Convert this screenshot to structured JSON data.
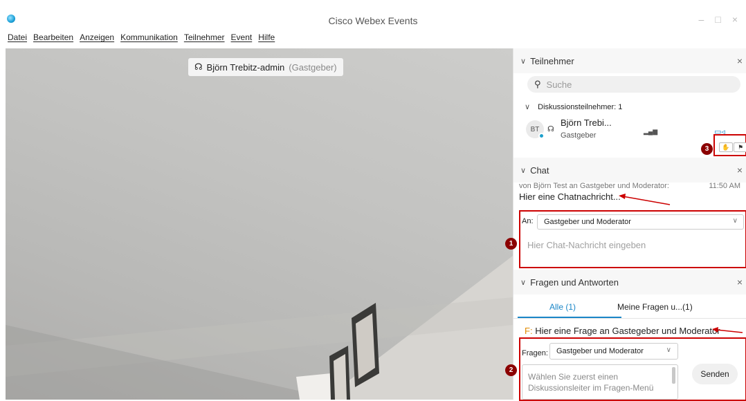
{
  "window": {
    "title": "Cisco Webex Events",
    "controls": [
      "–",
      "□",
      "×"
    ]
  },
  "menu": [
    "Datei",
    "Bearbeiten",
    "Anzeigen",
    "Kommunikation",
    "Teilnehmer",
    "Event",
    "Hilfe"
  ],
  "video": {
    "speaker_name": "Björn Trebitz-admin",
    "speaker_role": "(Gastgeber)"
  },
  "participants": {
    "header": "Teilnehmer",
    "search_placeholder": "Suche",
    "panelists_label": "Diskussionsteilnehmer: 1",
    "items": [
      {
        "initials": "BT",
        "name": "Björn Trebi...",
        "role": "Gastgeber"
      }
    ]
  },
  "chat": {
    "header": "Chat",
    "message_meta": "von Björn Test an Gastgeber und Moderator:",
    "message_time": "11:50 AM",
    "message_text": "Hier eine Chatnachricht...",
    "to_label": "An:",
    "to_value": "Gastgeber und Moderator",
    "input_placeholder": "Hier Chat-Nachricht eingeben"
  },
  "qa": {
    "header": "Fragen und Antworten",
    "tabs": [
      "Alle (1)",
      "Meine Fragen u...(1)"
    ],
    "question_prefix": "F:",
    "question_text": "Hier eine Frage an Gastegeber und Moderator",
    "ask_label": "Fragen:",
    "ask_value": "Gastgeber und Moderator",
    "input_placeholder": "Wählen Sie zuerst einen Diskussionsleiter im Fragen-Menü",
    "send_label": "Senden"
  },
  "annotations": [
    "1",
    "2",
    "3"
  ],
  "colors": {
    "accent": "#1a86c7",
    "annotation": "#c00000",
    "question_prefix": "#e08a00"
  }
}
